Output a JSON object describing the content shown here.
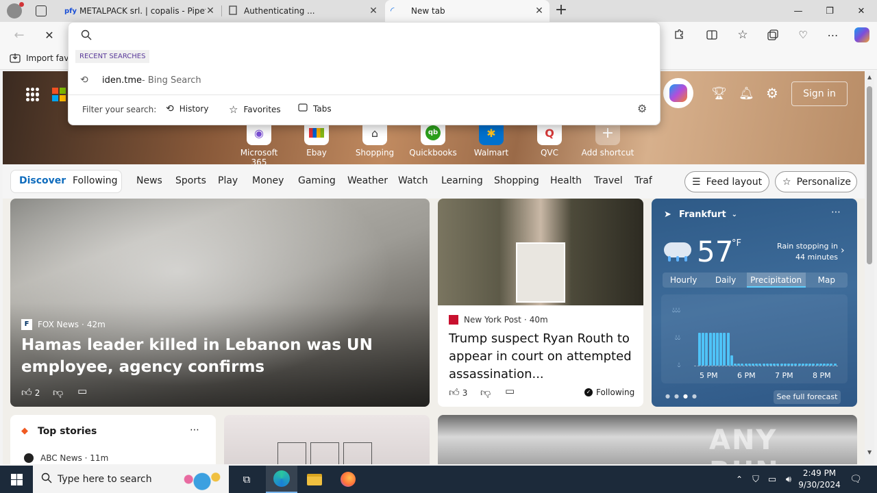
{
  "tabs": [
    {
      "label": "METALPACK srl. | copalis - Pipefy",
      "favicon": "pfy"
    },
    {
      "label": "Authenticating ..."
    },
    {
      "label": "New tab"
    }
  ],
  "window": {
    "minimize": "—",
    "maximize": "❐",
    "close": "✕",
    "new_tab": "+"
  },
  "favorites_bar": {
    "import_label": "Import favo"
  },
  "omnibox": {
    "input_value": "",
    "recent_header": "RECENT SEARCHES",
    "recent_item": "iden.tme",
    "recent_item_suffix": " - Bing Search",
    "filter_label": "Filter your search:",
    "filters": [
      "History",
      "Favorites",
      "Tabs"
    ]
  },
  "header": {
    "sign_in": "Sign in"
  },
  "shortcuts": [
    {
      "label": "Microsoft 365",
      "icon": "m365-icon",
      "color": "#7b4fd6"
    },
    {
      "label": "Ebay",
      "icon": "ebay-icon",
      "color": "#333333"
    },
    {
      "label": "Shopping",
      "icon": "tag-icon",
      "color": "#444444"
    },
    {
      "label": "Quickbooks",
      "icon": "qb-icon",
      "color": "#2ca01c"
    },
    {
      "label": "Walmart",
      "icon": "walmart-icon",
      "color": "#0071ce"
    },
    {
      "label": "QVC",
      "icon": "qvc-icon",
      "color": "#d83a3a"
    },
    {
      "label": "Add shortcut",
      "icon": "plus-icon",
      "color": "#ffffff"
    }
  ],
  "nav": {
    "discover": "Discover",
    "following": "Following",
    "items": [
      "News",
      "Sports",
      "Play",
      "Money",
      "Gaming",
      "Weather",
      "Watch",
      "Learning",
      "Shopping",
      "Health",
      "Travel",
      "Traf"
    ],
    "feed_layout": "Feed layout",
    "personalize": "Personalize"
  },
  "main_story": {
    "source": "FOX News",
    "age": "42m",
    "headline": "Hamas leader killed in Lebanon was UN employee, agency confirms",
    "likes": "2"
  },
  "second_story": {
    "source": "New York Post",
    "age": "40m",
    "headline": "Trump suspect Ryan Routh to appear in court on attempted assassination...",
    "likes": "3",
    "following": "Following"
  },
  "weather": {
    "city": "Frankfurt",
    "temp": "57",
    "unit": "°F",
    "note": "Rain stopping in 44 minutes",
    "tabs": [
      "Hourly",
      "Daily",
      "Precipitation",
      "Map"
    ],
    "selected_tab": "Precipitation",
    "times": [
      "5 PM",
      "6 PM",
      "7 PM",
      "8 PM"
    ],
    "see_full": "See full forecast",
    "precip_bars": [
      0.8,
      0.8,
      0.8,
      0.8,
      0.8,
      0.8,
      0.8,
      0.8,
      0.8,
      0.25,
      0.05,
      0.05,
      0.05,
      0.05,
      0.05,
      0.05,
      0.05,
      0.05,
      0.05,
      0.05,
      0.05,
      0.05,
      0.05,
      0.05,
      0.05,
      0.05,
      0.05,
      0.05,
      0.05,
      0.05,
      0.05,
      0.05,
      0.05,
      0.05,
      0.05,
      0.05,
      0.05,
      0.05,
      0.05
    ]
  },
  "top_stories": {
    "title": "Top stories",
    "first_source": "ABC News · 11m"
  },
  "watermark": "ANY RUN",
  "taskbar": {
    "search_placeholder": "Type here to search",
    "time": "2:49 PM",
    "date": "9/30/2024"
  }
}
